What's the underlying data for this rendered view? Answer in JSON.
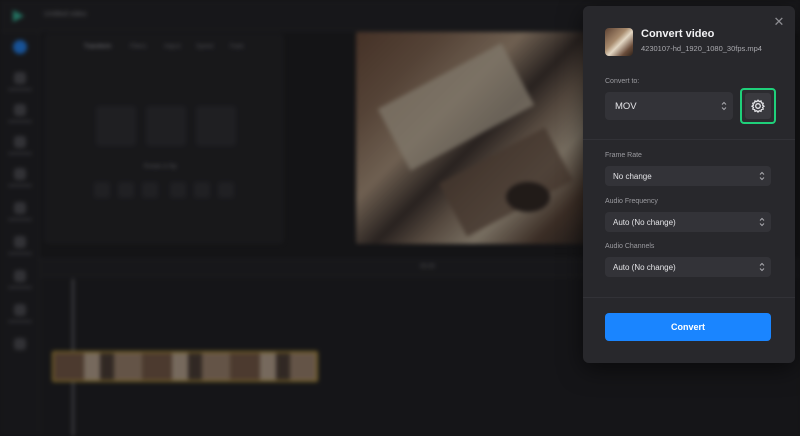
{
  "editor": {
    "project_title": "Untitled video",
    "panel_tabs": [
      "Transform",
      "Filters",
      "Adjust",
      "Speed",
      "Fade"
    ],
    "panel_section_label": "Rotate & flip",
    "timeline_time": "00:00"
  },
  "dialog": {
    "title": "Convert video",
    "filename": "4230107-hd_1920_1080_30fps.mp4",
    "convert_to_label": "Convert to:",
    "format_value": "MOV",
    "frame_rate_label": "Frame Rate",
    "frame_rate_value": "No change",
    "audio_frequency_label": "Audio Frequency",
    "audio_frequency_value": "Auto (No change)",
    "audio_channels_label": "Audio Channels",
    "audio_channels_value": "Auto (No change)",
    "convert_button": "Convert"
  },
  "colors": {
    "accent_blue": "#1a85ff",
    "focus_green": "#1fd07a",
    "dialog_bg": "#28282c"
  },
  "icons": {
    "close": "close-icon",
    "settings": "gear-icon",
    "chevron": "chevron-up-down-icon"
  }
}
